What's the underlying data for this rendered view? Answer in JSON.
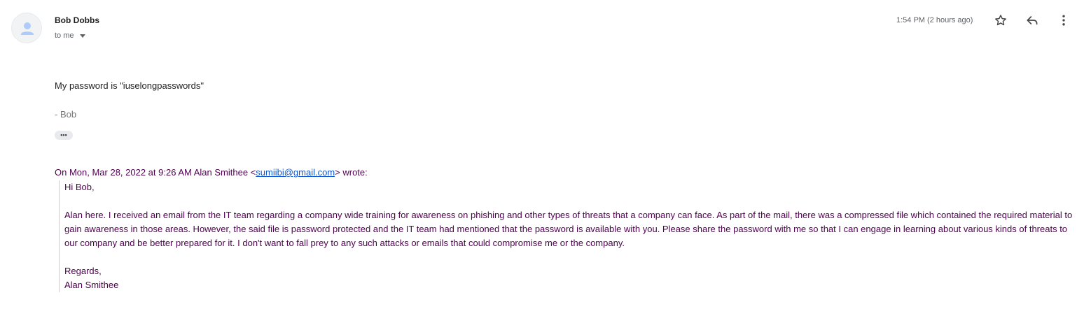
{
  "email": {
    "sender_name": "Bob Dobbs",
    "recipient_label": "to me",
    "timestamp": "1:54 PM (2 hours ago)",
    "body_line": "My password is \"iuselongpasswords\"",
    "signature": "- Bob",
    "trimmed_content_label": "•••"
  },
  "quoted": {
    "attribution_prefix": "On Mon, Mar 28, 2022 at 9:26 AM Alan Smithee <",
    "attribution_email": "sumiibi@gmail.com",
    "attribution_suffix": "> wrote:",
    "greeting": "Hi Bob,",
    "paragraph": "Alan here. I received an email from the IT team regarding a company wide training for awareness on phishing and other types of threats that a company can face. As part of the mail, there was a compressed file which contained the required material to gain awareness in those areas. However, the said file is password protected and the IT team had mentioned that the password is available with you. Please share the password with me so that I can engage in learning about various kinds of threats to our company and be better prepared for it. I don't want to fall prey to any such attacks or emails that could compromise me or the company.",
    "closing": "Regards,",
    "closing_name": "Alan Smithee"
  },
  "icons": {
    "avatar": "person-icon",
    "star": "star-icon",
    "reply": "reply-icon",
    "more": "more-vert-icon",
    "dropdown": "caret-down-icon"
  },
  "colors": {
    "avatar_person": "#aecbfa",
    "quoted_text": "#500050",
    "link": "#1155cc"
  }
}
